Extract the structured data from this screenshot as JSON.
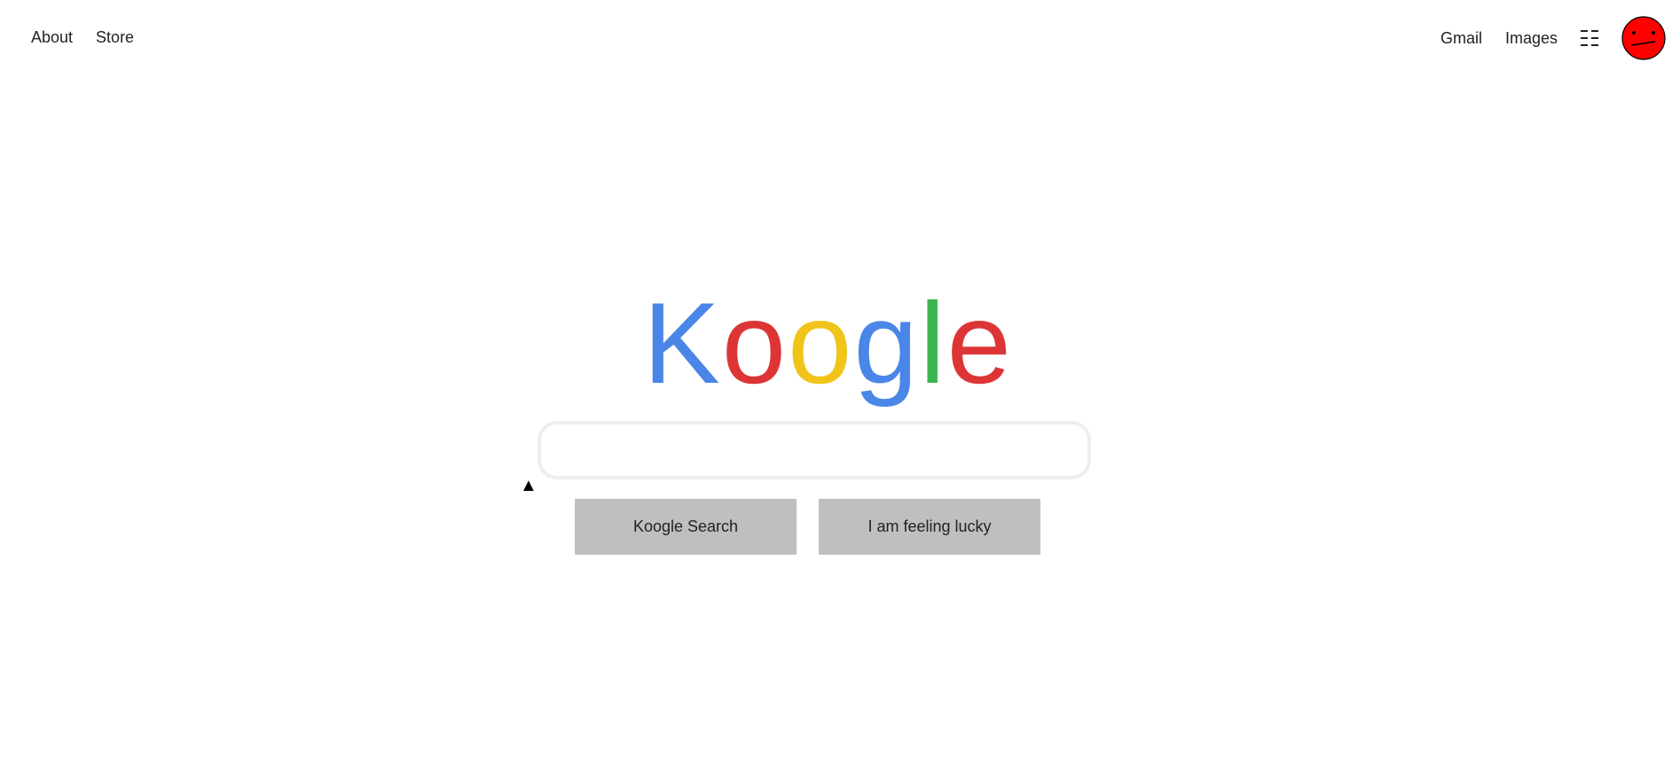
{
  "header": {
    "left_links": [
      "About",
      "Store"
    ],
    "right_links": [
      "Gmail",
      "Images"
    ],
    "apps_icon": "apps-grid-icon",
    "avatar_icon": "red-face-avatar-icon"
  },
  "logo": {
    "letters": [
      {
        "char": "K",
        "color": "#4a86e8"
      },
      {
        "char": "o",
        "color": "#dd3535"
      },
      {
        "char": "o",
        "color": "#f0c419"
      },
      {
        "char": "g",
        "color": "#4a86e8"
      },
      {
        "char": "l",
        "color": "#3bb552"
      },
      {
        "char": "e",
        "color": "#dd3535"
      }
    ]
  },
  "search": {
    "value": "",
    "placeholder": ""
  },
  "caret_marker": "▲",
  "buttons": {
    "search_label": "Koogle Search",
    "lucky_label": "I am feeling lucky"
  },
  "colors": {
    "button_bg": "#bfbfbf",
    "avatar_fill": "#ff0000",
    "search_border": "#eeeeee"
  }
}
